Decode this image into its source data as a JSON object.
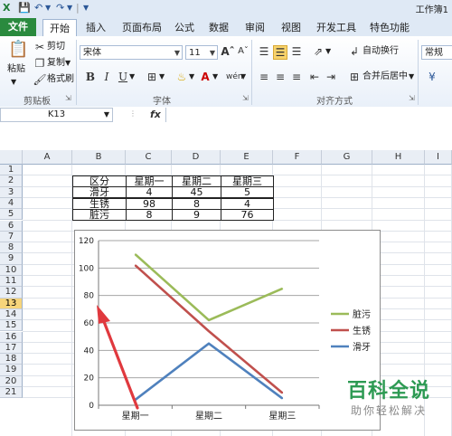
{
  "window": {
    "title": "工作簿1"
  },
  "ribbon": {
    "tabs": [
      "文件",
      "开始",
      "插入",
      "页面布局",
      "公式",
      "数据",
      "审阅",
      "视图",
      "开发工具",
      "特色功能"
    ],
    "active_tab": "开始",
    "clipboard": {
      "paste": "粘贴",
      "cut": "剪切",
      "copy": "复制",
      "format_painter": "格式刷",
      "group": "剪贴板"
    },
    "font": {
      "name": "宋体",
      "size": "11",
      "bold": "B",
      "italic": "I",
      "underline": "U",
      "group": "字体"
    },
    "alignment": {
      "wrap_text": "自动换行",
      "merge_center": "合并后居中",
      "group": "对齐方式"
    },
    "number": {
      "format": "常规"
    }
  },
  "formula_bar": {
    "name_box": "K13",
    "fx": "fx",
    "value": ""
  },
  "grid": {
    "columns": [
      "A",
      "B",
      "C",
      "D",
      "E",
      "F",
      "G",
      "H",
      "I"
    ],
    "rows": [
      "1",
      "2",
      "3",
      "4",
      "5",
      "6",
      "7",
      "8",
      "9",
      "10",
      "11",
      "12",
      "13",
      "14",
      "15",
      "16",
      "17",
      "18",
      "19",
      "20",
      "21"
    ],
    "selected_row": "13"
  },
  "table": {
    "header": [
      "区分",
      "星期一",
      "星期二",
      "星期三"
    ],
    "rows": [
      [
        "滑牙",
        "4",
        "45",
        "5"
      ],
      [
        "生锈",
        "98",
        "8",
        "4"
      ],
      [
        "脏污",
        "8",
        "9",
        "76"
      ]
    ]
  },
  "chart_data": {
    "type": "line",
    "categories": [
      "星期一",
      "星期二",
      "星期三"
    ],
    "series": [
      {
        "name": "脏污",
        "values": [
          110,
          62,
          85
        ],
        "color": "#9bbb59"
      },
      {
        "name": "生锈",
        "values": [
          102,
          54,
          9
        ],
        "color": "#c0504d"
      },
      {
        "name": "滑牙",
        "values": [
          4,
          45,
          5
        ],
        "color": "#4f81bd"
      }
    ],
    "ylim": [
      0,
      120
    ],
    "yticks": [
      0,
      20,
      40,
      60,
      80,
      100,
      120
    ],
    "grid": true,
    "legend": "right",
    "annotation": {
      "type": "arrow",
      "color": "#e0393e"
    }
  },
  "watermark": {
    "main": "百科全说",
    "sub": "助你轻松解决"
  }
}
